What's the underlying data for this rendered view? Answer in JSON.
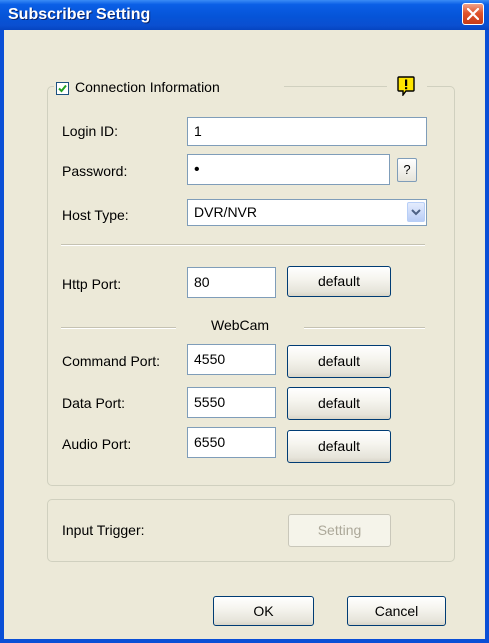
{
  "window": {
    "title": "Subscriber Setting"
  },
  "connection": {
    "checkbox_label": "Connection Information",
    "checked": true,
    "login_id_label": "Login ID:",
    "login_id_value": "1",
    "password_label": "Password:",
    "password_value": "•",
    "help_label": "?",
    "host_type_label": "Host Type:",
    "host_type_value": "DVR/NVR",
    "http_port_label": "Http Port:",
    "http_port_value": "80",
    "http_default_label": "default",
    "webcam_label": "WebCam",
    "command_port_label": "Command Port:",
    "command_port_value": "4550",
    "command_default_label": "default",
    "data_port_label": "Data Port:",
    "data_port_value": "5550",
    "data_default_label": "default",
    "audio_port_label": "Audio Port:",
    "audio_port_value": "6550",
    "audio_default_label": "default"
  },
  "trigger": {
    "label": "Input Trigger:",
    "setting_label": "Setting"
  },
  "footer": {
    "ok_label": "OK",
    "cancel_label": "Cancel"
  },
  "colors": {
    "titlebar": "#0a5fe6",
    "dialog_face": "#ece9d8",
    "close_button": "#e0542c",
    "warning_icon": "#ffe600"
  },
  "icons": {
    "close": "close-icon",
    "warning": "warning-icon",
    "check": "checkmark-icon",
    "dropdown": "chevron-down-icon"
  }
}
